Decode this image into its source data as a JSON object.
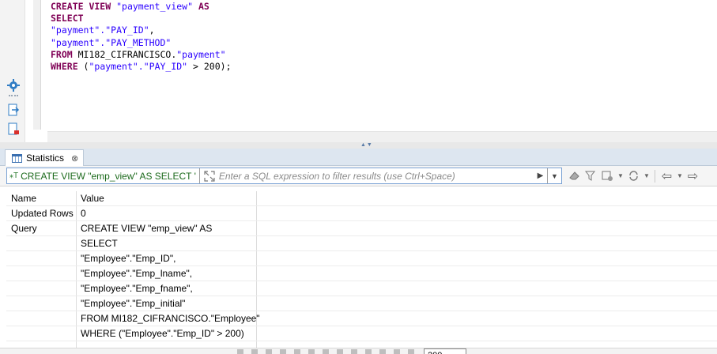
{
  "editor": {
    "lines": [
      [
        {
          "t": "CREATE VIEW ",
          "c": "kw"
        },
        {
          "t": "\"payment_view\"",
          "c": "str"
        },
        {
          "t": " AS",
          "c": "kw"
        }
      ],
      [
        {
          "t": "SELECT",
          "c": "kw"
        }
      ],
      [
        {
          "t": "\"payment\".\"PAY_ID\"",
          "c": "str"
        },
        {
          "t": ",",
          "c": "op"
        }
      ],
      [
        {
          "t": "\"payment\".\"PAY_METHOD\"",
          "c": "str"
        }
      ],
      [
        {
          "t": "FROM ",
          "c": "kw"
        },
        {
          "t": "MI182_CIFRANCISCO.",
          "c": "op"
        },
        {
          "t": "\"payment\"",
          "c": "str"
        }
      ],
      [
        {
          "t": "WHERE",
          "c": "kw"
        },
        {
          "t": " (",
          "c": "op"
        },
        {
          "t": "\"payment\".\"PAY_ID\"",
          "c": "str"
        },
        {
          "t": " > 200);",
          "c": "op"
        }
      ]
    ],
    "rail_icons": [
      "gear-icon",
      "export-icon",
      "script-icon"
    ]
  },
  "stats_tab": {
    "label": "Statistics",
    "close_glyph": "⊗"
  },
  "filter": {
    "query_chip": "CREATE VIEW \"emp_view\" AS SELECT '",
    "placeholder": "Enter a SQL expression to filter results (use Ctrl+Space)"
  },
  "results": {
    "columns": [
      "Name",
      "Value"
    ],
    "rows": [
      {
        "name": "Updated Rows",
        "value": "0"
      },
      {
        "name": "Query",
        "value": "CREATE VIEW \"emp_view\" AS"
      },
      {
        "name": "",
        "value": "SELECT"
      },
      {
        "name": "",
        "value": "\"Employee\".\"Emp_ID\","
      },
      {
        "name": "",
        "value": "\"Employee\".\"Emp_lname\","
      },
      {
        "name": "",
        "value": "\"Employee\".\"Emp_fname\","
      },
      {
        "name": "",
        "value": "\"Employee\".\"Emp_initial\""
      },
      {
        "name": "",
        "value": "FROM MI182_CIFRANCISCO.\"Employee\""
      },
      {
        "name": "",
        "value": "WHERE (\"Employee\".\"Emp_ID\" > 200)"
      }
    ]
  },
  "bottom": {
    "fetch_size": "200"
  }
}
